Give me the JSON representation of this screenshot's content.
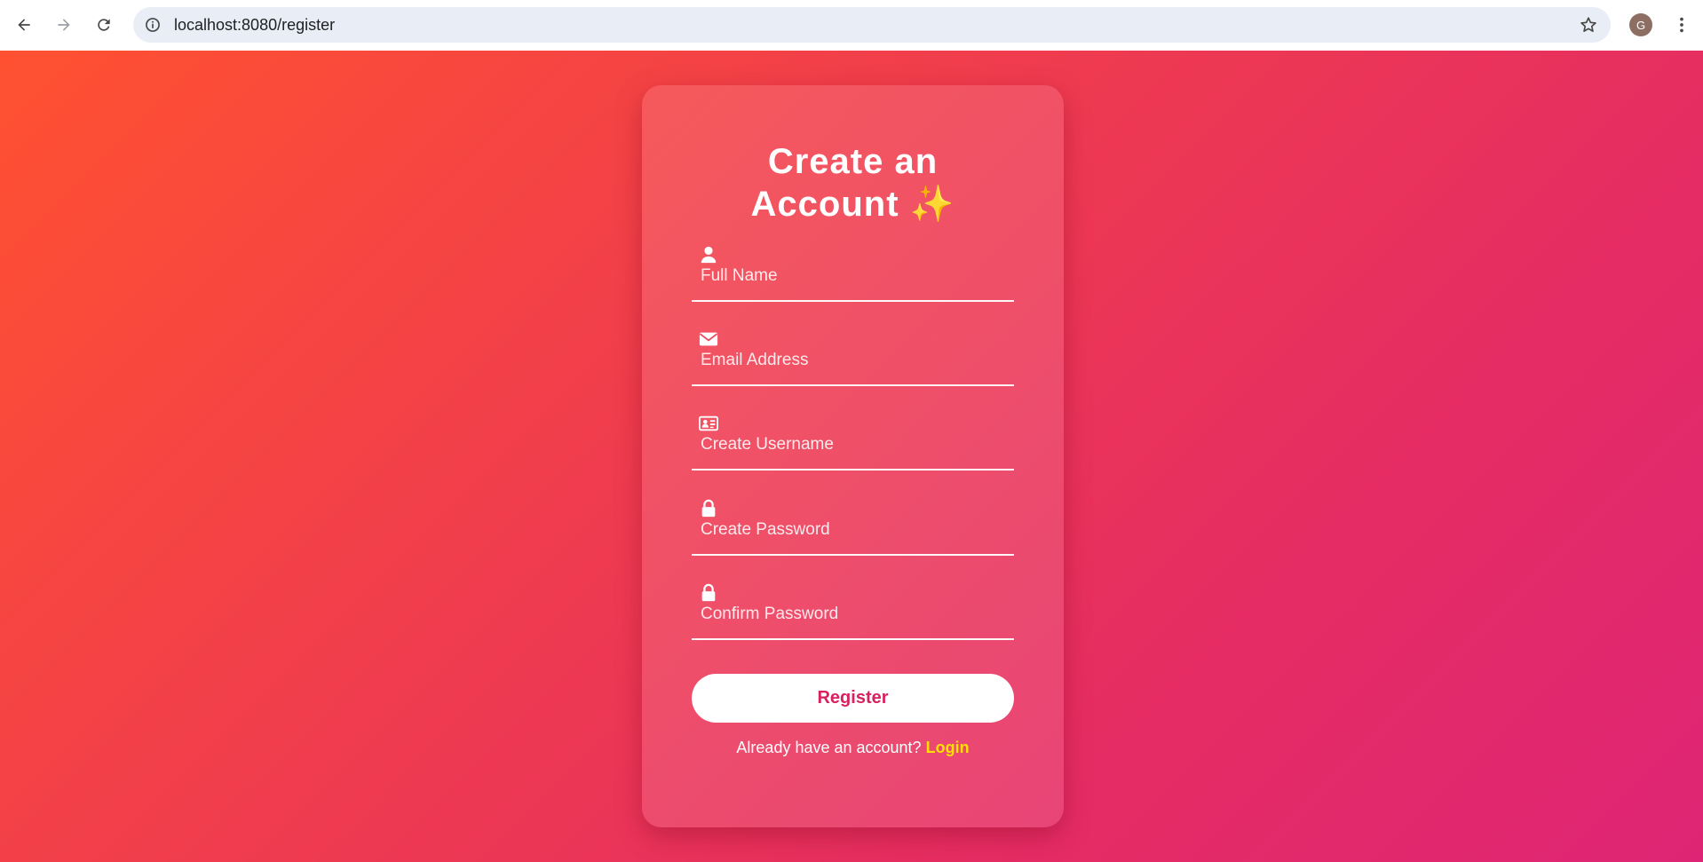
{
  "browser": {
    "url": "localhost:8080/register",
    "profile_initial": "G",
    "icons": {
      "back": "arrow-left-icon",
      "forward": "arrow-right-icon",
      "reload": "reload-icon",
      "site_info": "info-icon",
      "bookmark": "star-icon",
      "menu": "more-vert-icon"
    }
  },
  "form": {
    "title_line1": "Create an",
    "title_line2": "Account",
    "title_emoji": "✨",
    "fields": [
      {
        "placeholder": "Full Name",
        "icon": "user-icon",
        "value": ""
      },
      {
        "placeholder": "Email Address",
        "icon": "envelope-icon",
        "value": ""
      },
      {
        "placeholder": "Create Username",
        "icon": "id-card-icon",
        "value": ""
      },
      {
        "placeholder": "Create Password",
        "icon": "lock-icon",
        "value": ""
      },
      {
        "placeholder": "Confirm Password",
        "icon": "lock-icon",
        "value": ""
      }
    ],
    "submit_label": "Register",
    "login_prompt": "Already have an account?",
    "login_link": "Login"
  },
  "colors": {
    "gradient_start": "#ff5131",
    "gradient_end": "#de2575",
    "button_text": "#d8215e",
    "link": "#ffe000"
  }
}
